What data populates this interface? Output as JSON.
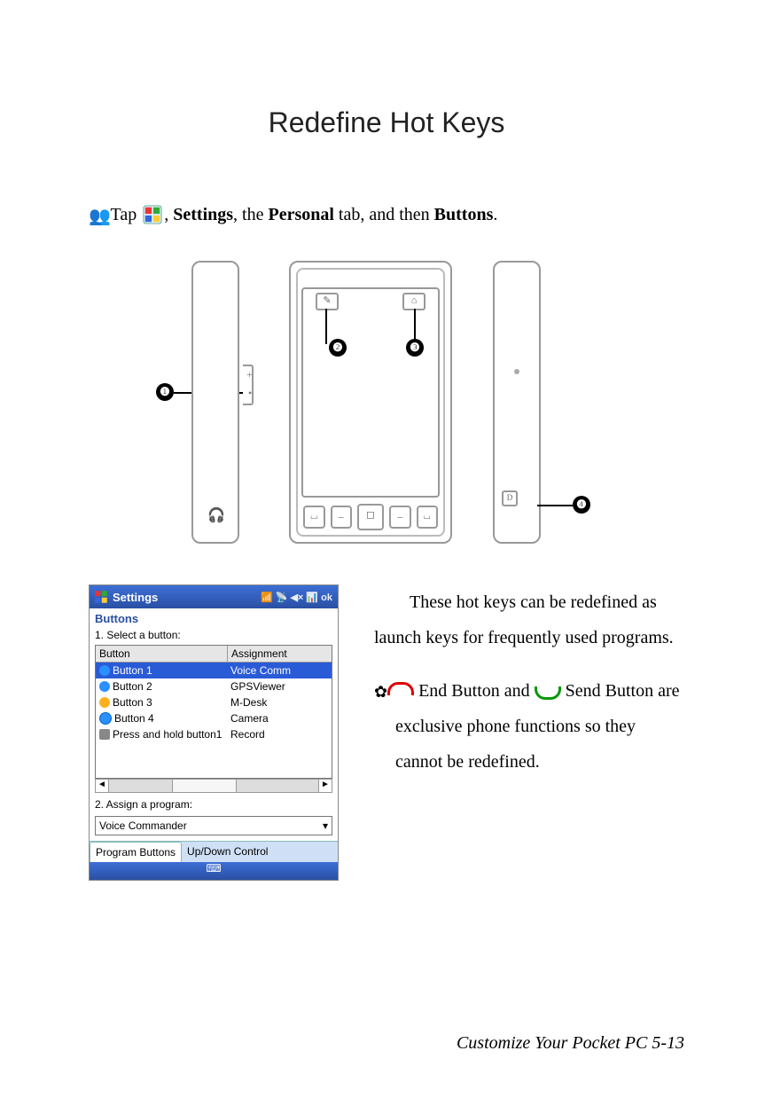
{
  "title": "Redefine Hot Keys",
  "instruction": {
    "tap": "Tap",
    "comma1": ", ",
    "settings": "Settings",
    "comma2": ", the ",
    "personal": "Personal",
    "mid": " tab, and then ",
    "buttons": "Buttons",
    "end": "."
  },
  "callouts": {
    "c1": "❶",
    "c2": "❷",
    "c3": "❸",
    "c4": "❹"
  },
  "screenshot": {
    "titlebar": "Settings",
    "status_icons": "📶 📡 ◀× 📊 ok",
    "header": "Buttons",
    "step1": "1. Select a button:",
    "col_button": "Button",
    "col_assign": "Assignment",
    "rows": [
      {
        "btn": "Button 1",
        "asg": "Voice Comm"
      },
      {
        "btn": "Button 2",
        "asg": "GPSViewer"
      },
      {
        "btn": "Button 3",
        "asg": "M-Desk"
      },
      {
        "btn": "Button 4",
        "asg": "Camera"
      },
      {
        "btn": "Press and hold button1",
        "asg": "Record"
      }
    ],
    "step2": "2. Assign a program:",
    "dropdown": "Voice Commander",
    "tab1": "Program Buttons",
    "tab2": "Up/Down Control"
  },
  "body": {
    "p1": "These hot keys can be redefined as launch keys for frequently used programs.",
    "note_a": " End Button and ",
    "note_b": " Send Button are exclusive phone functions so they cannot be redefined."
  },
  "footer": "Customize Your Pocket PC    5-13"
}
